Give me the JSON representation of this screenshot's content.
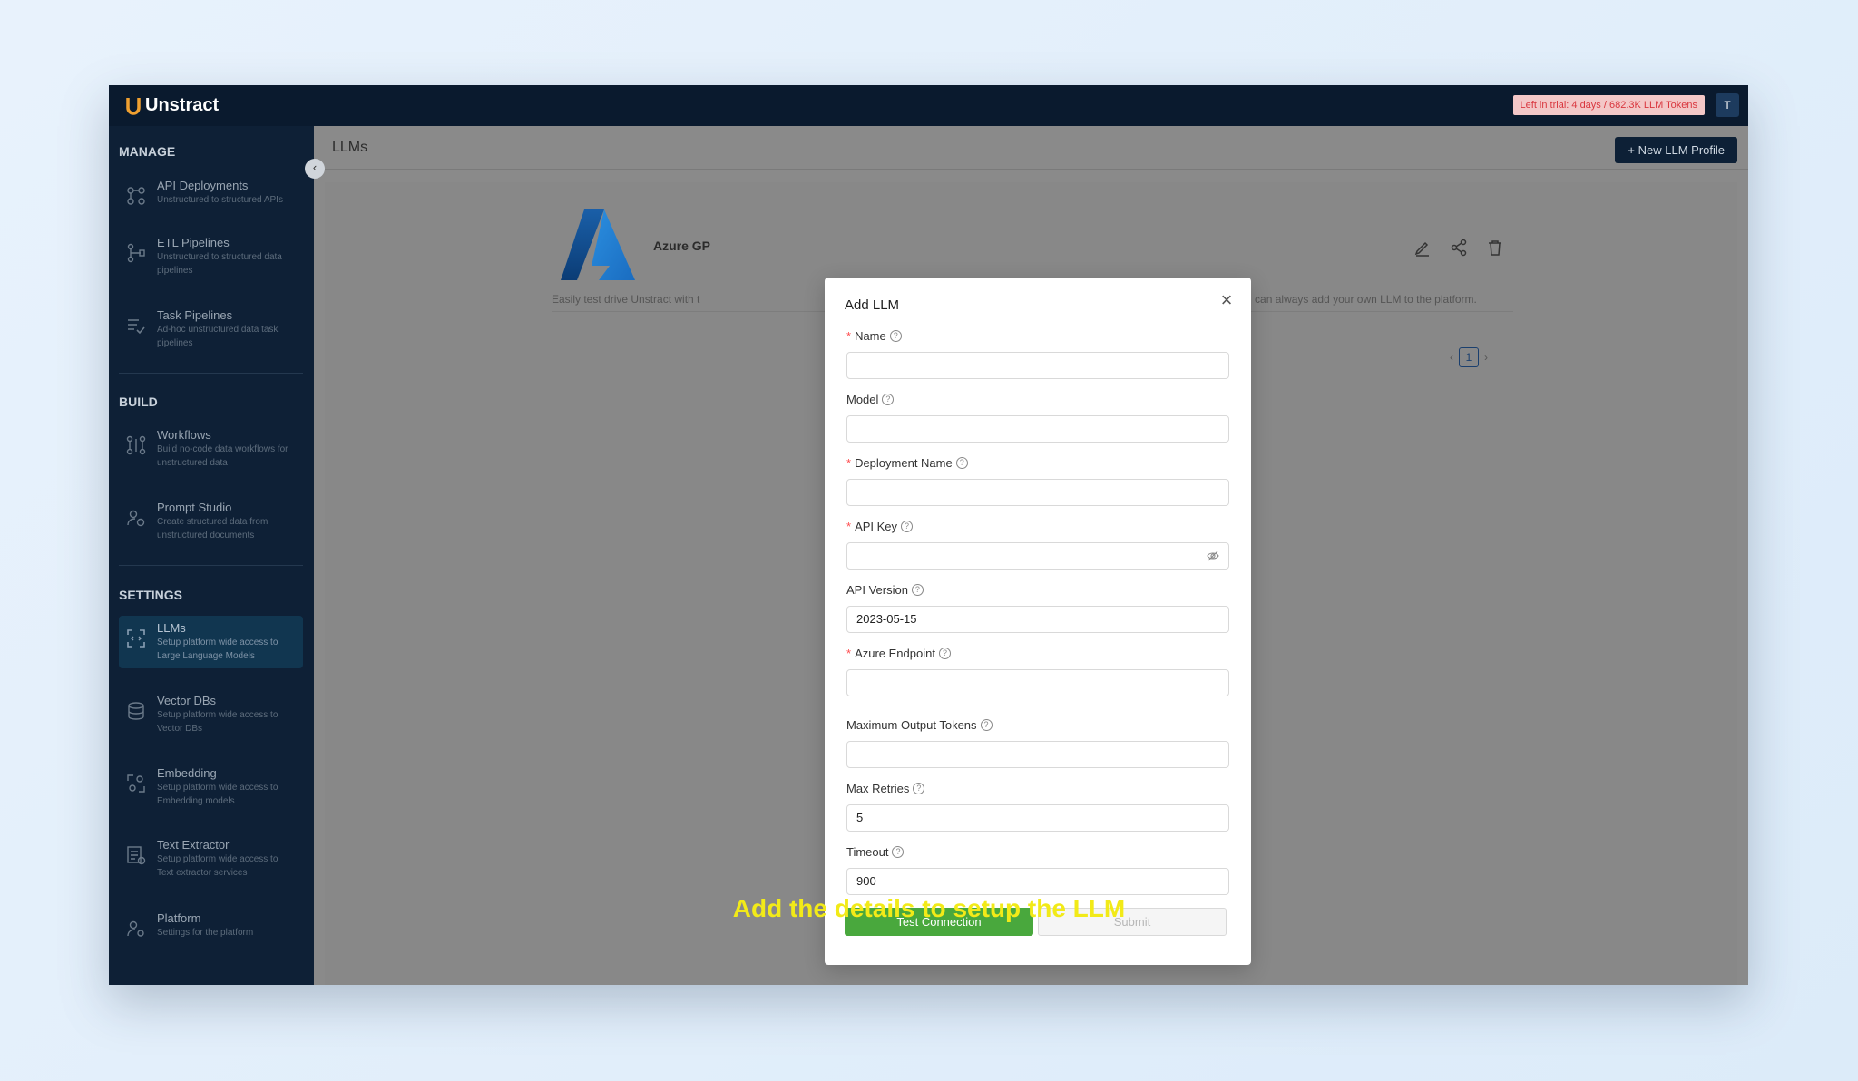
{
  "app": {
    "logo_text": "Unstract",
    "trial_badge": "Left in trial: 4 days / 682.3K LLM Tokens",
    "avatar_initial": "T"
  },
  "sidebar": {
    "collapse_icon": "chevron-left-icon",
    "sections": [
      {
        "title": "MANAGE",
        "items": [
          {
            "icon": "api-icon",
            "title": "API Deployments",
            "desc": "Unstructured to structured APIs"
          },
          {
            "icon": "etl-icon",
            "title": "ETL Pipelines",
            "desc": "Unstructured to structured data pipelines"
          },
          {
            "icon": "task-icon",
            "title": "Task Pipelines",
            "desc": "Ad-hoc unstructured data task pipelines"
          }
        ]
      },
      {
        "title": "BUILD",
        "items": [
          {
            "icon": "workflow-icon",
            "title": "Workflows",
            "desc": "Build no-code data workflows for unstructured data"
          },
          {
            "icon": "prompt-studio-icon",
            "title": "Prompt Studio",
            "desc": "Create structured data from unstructured documents"
          }
        ]
      },
      {
        "title": "SETTINGS",
        "items": [
          {
            "icon": "llm-icon",
            "title": "LLMs",
            "desc": "Setup platform wide access to Large Language Models",
            "active": true
          },
          {
            "icon": "database-icon",
            "title": "Vector DBs",
            "desc": "Setup platform wide access to Vector DBs"
          },
          {
            "icon": "embedding-icon",
            "title": "Embedding",
            "desc": "Setup platform wide access to Embedding models"
          },
          {
            "icon": "text-extractor-icon",
            "title": "Text Extractor",
            "desc": "Setup platform wide access to Text extractor services"
          },
          {
            "icon": "platform-icon",
            "title": "Platform",
            "desc": "Settings for the platform"
          }
        ]
      }
    ]
  },
  "page": {
    "title": "LLMs",
    "new_button_label": "New LLM Profile",
    "card": {
      "name": "Azure GP",
      "desc_left": "Easily test drive Unstract with t",
      "desc_right": "f free trial credits, you can always add your own LLM to the platform."
    },
    "pagination": {
      "current": "1"
    }
  },
  "modal": {
    "title": "Add LLM",
    "fields": [
      {
        "label": "Name",
        "required": true,
        "value": ""
      },
      {
        "label": "Model",
        "required": false,
        "value": ""
      },
      {
        "label": "Deployment Name",
        "required": true,
        "value": ""
      },
      {
        "label": "API Key",
        "required": true,
        "value": "",
        "password": true
      },
      {
        "label": "API Version",
        "required": false,
        "value": "2023-05-15"
      },
      {
        "label": "Azure Endpoint",
        "required": true,
        "value": ""
      },
      {
        "label": "Maximum Output Tokens",
        "required": false,
        "value": ""
      },
      {
        "label": "Max Retries",
        "required": false,
        "value": "5"
      },
      {
        "label": "Timeout",
        "required": false,
        "value": "900"
      }
    ],
    "test_button": "Test Connection",
    "submit_button": "Submit"
  },
  "caption": "Add the details to setup the LLM",
  "colors": {
    "primary_dark": "#0a1a2e",
    "success": "#49a83d",
    "caption": "#f2ea18",
    "required": "#ff4d4f"
  }
}
